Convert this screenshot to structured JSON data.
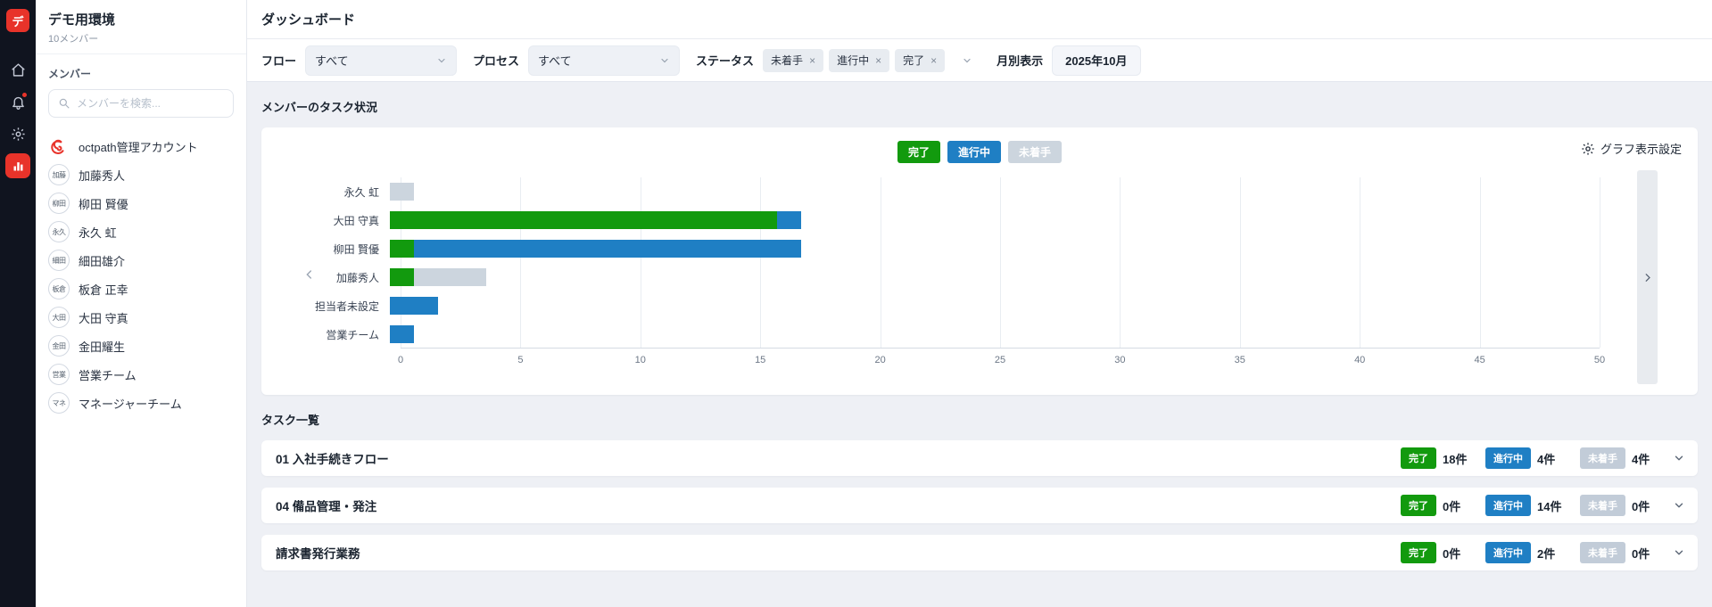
{
  "colors": {
    "accent_red": "#e8332a",
    "done_green": "#129a0e",
    "progress_blue": "#1f7fc4",
    "notstarted_gray": "#c2ccd8",
    "notstarted_bar_gray": "#ccd5de"
  },
  "iconbar": {
    "logo_text": "デ",
    "items": [
      {
        "icon": "home",
        "name": "nav-home"
      },
      {
        "icon": "bell",
        "name": "nav-notifications",
        "badge": true
      },
      {
        "icon": "gear",
        "name": "nav-settings"
      },
      {
        "icon": "chart",
        "name": "nav-dashboard",
        "active": true
      }
    ]
  },
  "sidebar": {
    "workspace_name": "デモ用環境",
    "workspace_members": "10メンバー",
    "members_label": "メンバー",
    "search_placeholder": "メンバーを検索...",
    "members": [
      {
        "logo": true,
        "initials": "",
        "name": "octpath管理アカウント"
      },
      {
        "initials": "加藤",
        "name": "加藤秀人"
      },
      {
        "initials": "柳田",
        "name": "柳田 賢優"
      },
      {
        "initials": "永久",
        "name": "永久 虹"
      },
      {
        "initials": "細田",
        "name": "細田雄介"
      },
      {
        "initials": "板倉",
        "name": "板倉 正幸"
      },
      {
        "initials": "大田",
        "name": "大田 守真"
      },
      {
        "initials": "金田",
        "name": "金田耀生"
      },
      {
        "initials": "営業",
        "name": "営業チーム"
      },
      {
        "initials": "マネ",
        "name": "マネージャーチーム"
      }
    ]
  },
  "header": {
    "title": "ダッシュボード"
  },
  "filters": {
    "flow_label": "フロー",
    "flow_value": "すべて",
    "process_label": "プロセス",
    "process_value": "すべて",
    "status_label": "ステータス",
    "status_tags": [
      "未着手",
      "進行中",
      "完了"
    ],
    "monthly_label": "月別表示",
    "monthly_value": "2025年10月"
  },
  "task_status_section": {
    "settings_label": "グラフ表示設定"
  },
  "chart_data": {
    "type": "bar",
    "orientation": "horizontal",
    "stacked": true,
    "title": "メンバーのタスク状況",
    "categories": [
      "永久 虹",
      "大田 守真",
      "柳田 賢優",
      "加藤秀人",
      "担当者未設定",
      "営業チーム"
    ],
    "series": [
      {
        "key": "done",
        "name": "完了",
        "color": "#129a0e",
        "values": [
          0,
          16,
          1,
          1,
          0,
          0
        ]
      },
      {
        "key": "in-progress",
        "name": "進行中",
        "color": "#1f7fc4",
        "values": [
          0,
          1,
          16,
          0,
          2,
          1
        ]
      },
      {
        "key": "not-started",
        "name": "未着手",
        "color": "#ccd5de",
        "values": [
          1,
          0,
          0,
          3,
          0,
          0
        ]
      }
    ],
    "xlim": [
      0,
      50
    ],
    "xticks": [
      0,
      5,
      10,
      15,
      20,
      25,
      30,
      35,
      40,
      45,
      50
    ],
    "grid": true,
    "legend_position": "top-center"
  },
  "task_list": {
    "title": "タスク一覧",
    "badge_labels": {
      "done": "完了",
      "progress": "進行中",
      "notstarted": "未着手"
    },
    "rows": [
      {
        "name": "01 入社手続きフロー",
        "done": "18件",
        "progress": "4件",
        "notstarted": "4件"
      },
      {
        "name": "04 備品管理・発注",
        "done": "0件",
        "progress": "14件",
        "notstarted": "0件"
      },
      {
        "name": "請求書発行業務",
        "done": "0件",
        "progress": "2件",
        "notstarted": "0件"
      }
    ]
  }
}
